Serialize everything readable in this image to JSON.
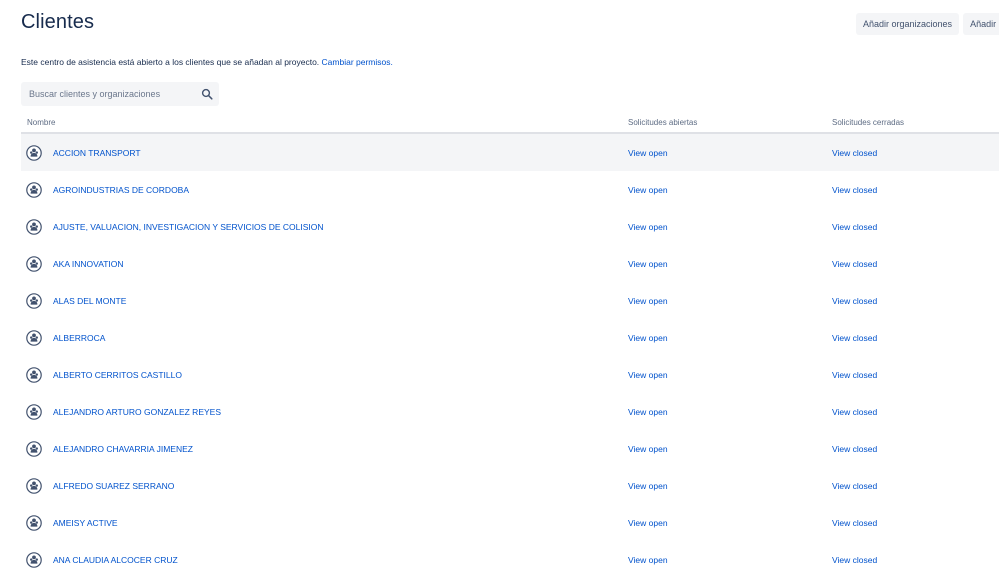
{
  "header": {
    "title": "Clientes",
    "actions": [
      {
        "label": "Añadir organizaciones"
      },
      {
        "label": "Añadir clientes"
      }
    ]
  },
  "info": {
    "text": "Este centro de asistencia está abierto a los clientes que se añadan al proyecto.",
    "link": "Cambiar permisos."
  },
  "search": {
    "placeholder": "Buscar clientes y organizaciones",
    "value": ""
  },
  "table": {
    "columns": {
      "name": "Nombre",
      "open": "Solicitudes abiertas",
      "closed": "Solicitudes cerradas"
    },
    "rows": [
      {
        "name": "ACCION TRANSPORT",
        "open": "View open",
        "closed": "View closed"
      },
      {
        "name": "AGROINDUSTRIAS DE CORDOBA",
        "open": "View open",
        "closed": "View closed"
      },
      {
        "name": "AJUSTE, VALUACION, INVESTIGACION Y SERVICIOS DE COLISION",
        "open": "View open",
        "closed": "View closed"
      },
      {
        "name": "AKA INNOVATION",
        "open": "View open",
        "closed": "View closed"
      },
      {
        "name": "ALAS DEL MONTE",
        "open": "View open",
        "closed": "View closed"
      },
      {
        "name": "ALBERROCA",
        "open": "View open",
        "closed": "View closed"
      },
      {
        "name": "ALBERTO CERRITOS CASTILLO",
        "open": "View open",
        "closed": "View closed"
      },
      {
        "name": "ALEJANDRO ARTURO GONZALEZ REYES",
        "open": "View open",
        "closed": "View closed"
      },
      {
        "name": "ALEJANDRO CHAVARRIA JIMENEZ",
        "open": "View open",
        "closed": "View closed"
      },
      {
        "name": "ALFREDO SUAREZ SERRANO",
        "open": "View open",
        "closed": "View closed"
      },
      {
        "name": "AMEISY ACTIVE",
        "open": "View open",
        "closed": "View closed"
      },
      {
        "name": "ANA CLAUDIA ALCOCER CRUZ",
        "open": "View open",
        "closed": "View closed"
      }
    ]
  },
  "colors": {
    "link": "#0052cc",
    "text": "#172b4d",
    "muted": "#5e6c84",
    "button_bg": "#f4f5f7",
    "row_highlight": "#f4f5f7"
  },
  "icons": {
    "search": "search-icon",
    "row": "organization-icon"
  }
}
